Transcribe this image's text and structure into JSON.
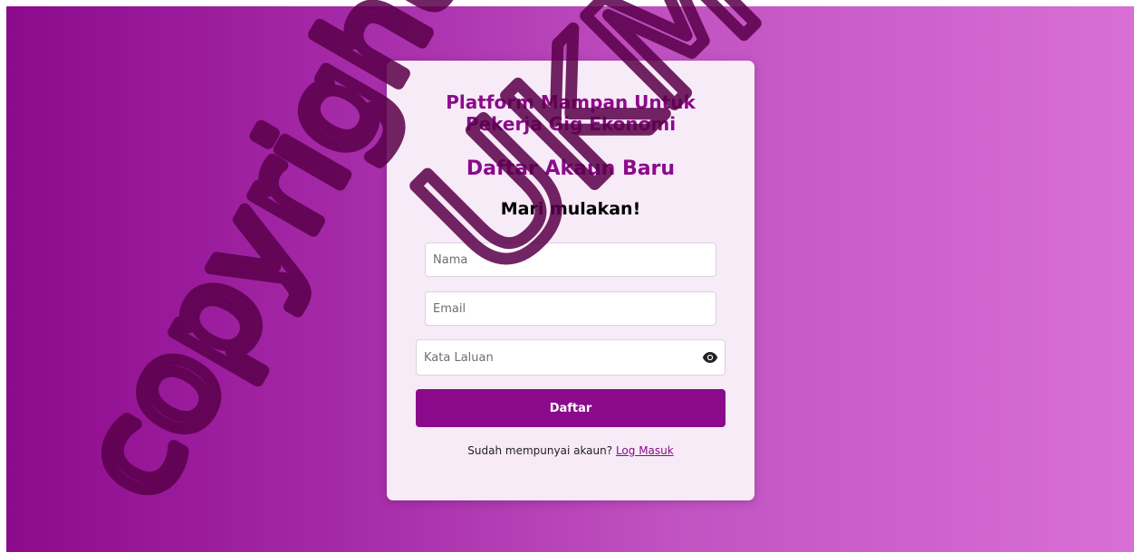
{
  "header": {
    "platform_title": "Platform Mampan Untuk Pekerja Gig Ekonomi",
    "form_title": "Daftar Akaun Baru",
    "subtitle": "Mari mulakan!"
  },
  "form": {
    "name_placeholder": "Nama",
    "email_placeholder": "Email",
    "password_placeholder": "Kata Laluan",
    "password_toggle_icon": "eye-icon",
    "submit_label": "Daftar"
  },
  "footer": {
    "prompt_text": "Sudah mempunyai akaun?",
    "login_link_label": "Log Masuk"
  },
  "watermark": {
    "line1": "copyright@",
    "line2": "UKM"
  },
  "colors": {
    "brand": "#8b0a8b",
    "card_background": "#f7ebf7",
    "gradient_start": "#8c0a8c",
    "gradient_end": "#d86fd6"
  }
}
